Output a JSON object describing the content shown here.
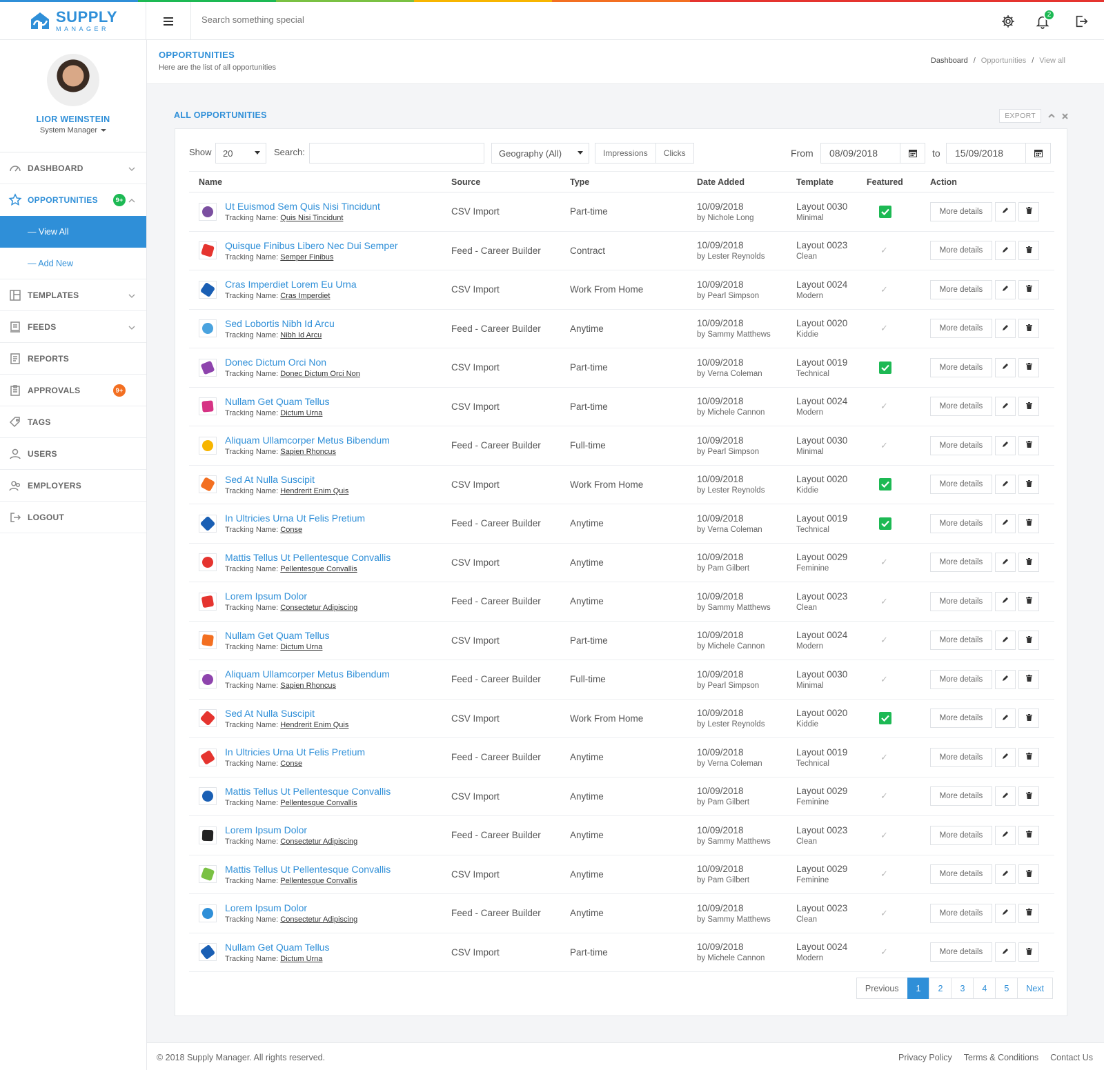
{
  "app": {
    "logo_main": "SUPPLY",
    "logo_sub": "MANAGER",
    "brand_color": "#2f8fd8",
    "rainbow_colors": [
      "#2f8fd8",
      "#1db954",
      "#7ac143",
      "#f7b500",
      "#f36f21",
      "#e5342f",
      "#e5342f",
      "#e5342f"
    ]
  },
  "topbar": {
    "menu_icon": "hamburger-icon",
    "search_placeholder": "Search something special",
    "notifications_count": "2"
  },
  "user": {
    "name": "LIOR WEINSTEIN",
    "role": "System Manager"
  },
  "sidebar": {
    "items": [
      {
        "label": "DASHBOARD",
        "icon": "speedometer-icon"
      },
      {
        "label": "OPPORTUNITIES",
        "icon": "star-icon",
        "badge": "9+"
      },
      {
        "label": "TEMPLATES",
        "icon": "layout-icon"
      },
      {
        "label": "FEEDS",
        "icon": "feed-icon"
      },
      {
        "label": "REPORTS",
        "icon": "report-icon"
      },
      {
        "label": "APPROVALS",
        "icon": "clipboard-icon",
        "badge": "9+"
      },
      {
        "label": "TAGS",
        "icon": "tag-icon"
      },
      {
        "label": "USERS",
        "icon": "user-icon"
      },
      {
        "label": "EMPLOYERS",
        "icon": "employers-icon"
      },
      {
        "label": "LOGOUT",
        "icon": "logout-icon"
      }
    ],
    "sub_items": [
      "— View All",
      "— Add New"
    ]
  },
  "page": {
    "title": "OPPORTUNITIES",
    "subtitle": "Here are the list of all opportunities",
    "breadcrumbs": [
      "Dashboard",
      "Opportunities",
      "View all"
    ]
  },
  "card": {
    "title": "ALL OPPORTUNITIES",
    "export_label": "EXPORT"
  },
  "filters": {
    "show_label": "Show",
    "show_value": "20",
    "search_label": "Search:",
    "geography": "Geography (All)",
    "toggle": [
      "Impressions",
      "Clicks"
    ],
    "from_label": "From",
    "from_date": "08/09/2018",
    "to_label": "to",
    "to_date": "15/09/2018"
  },
  "table": {
    "columns": [
      "Name",
      "Source",
      "Type",
      "Date Added",
      "Template",
      "Featured",
      "Action"
    ],
    "tracking_prefix": "Tracking Name:",
    "more_label": "More details",
    "rows": [
      {
        "name": "Ut Euismod Sem Quis Nisi Tincidunt",
        "tracking": "Quis Nisi Tincidunt",
        "source": "CSV Import",
        "type": "Part-time",
        "date": "10/09/2018",
        "by": "by Nichole Long",
        "template": "Layout 0030",
        "style": "Minimal",
        "featured": true,
        "logo": "#7b4fa0"
      },
      {
        "name": "Quisque Finibus Libero Nec Dui Semper",
        "tracking": "Semper Finibus",
        "source": "Feed - Career Builder",
        "type": "Contract",
        "date": "10/09/2018",
        "by": "by Lester Reynolds",
        "template": "Layout 0023",
        "style": "Clean",
        "featured": false,
        "logo": "#e5342f"
      },
      {
        "name": "Cras Imperdiet Lorem Eu Urna",
        "tracking": "Cras Imperdiet",
        "source": "CSV Import",
        "type": "Work From Home",
        "date": "10/09/2018",
        "by": "by Pearl Simpson",
        "template": "Layout 0024",
        "style": "Modern",
        "featured": false,
        "logo": "#1a5fb4"
      },
      {
        "name": "Sed Lobortis Nibh Id Arcu",
        "tracking": "Nibh Id Arcu",
        "source": "Feed - Career Builder",
        "type": "Anytime",
        "date": "10/09/2018",
        "by": "by Sammy Matthews",
        "template": "Layout 0020",
        "style": "Kiddie",
        "featured": false,
        "logo": "#4aa3df"
      },
      {
        "name": "Donec Dictum Orci Non",
        "tracking": "Donec Dictum Orci Non",
        "source": "CSV Import",
        "type": "Part-time",
        "date": "10/09/2018",
        "by": "by Verna Coleman",
        "template": "Layout 0019",
        "style": "Technical",
        "featured": true,
        "logo": "#8e44ad"
      },
      {
        "name": "Nullam Get Quam Tellus",
        "tracking": "Dictum Urna",
        "source": "CSV Import",
        "type": "Part-time",
        "date": "10/09/2018",
        "by": "by Michele Cannon",
        "template": "Layout 0024",
        "style": "Modern",
        "featured": false,
        "logo": "#d63384"
      },
      {
        "name": "Aliquam Ullamcorper Metus Bibendum",
        "tracking": "Sapien Rhoncus",
        "source": "Feed - Career Builder",
        "type": "Full-time",
        "date": "10/09/2018",
        "by": "by Pearl Simpson",
        "template": "Layout 0030",
        "style": "Minimal",
        "featured": false,
        "logo": "#f7b500"
      },
      {
        "name": "Sed At Nulla Suscipit",
        "tracking": "Hendrerit Enim Quis",
        "source": "CSV Import",
        "type": "Work From Home",
        "date": "10/09/2018",
        "by": "by Lester Reynolds",
        "template": "Layout 0020",
        "style": "Kiddie",
        "featured": true,
        "logo": "#f36f21"
      },
      {
        "name": "In Ultricies Urna Ut Felis Pretium",
        "tracking": "Conse",
        "source": "Feed - Career Builder",
        "type": "Anytime",
        "date": "10/09/2018",
        "by": "by Verna Coleman",
        "template": "Layout 0019",
        "style": "Technical",
        "featured": true,
        "logo": "#1a5fb4"
      },
      {
        "name": "Mattis Tellus Ut Pellentesque Convallis",
        "tracking": "Pellentesque Convallis",
        "source": "CSV Import",
        "type": "Anytime",
        "date": "10/09/2018",
        "by": "by Pam Gilbert",
        "template": "Layout 0029",
        "style": "Feminine",
        "featured": false,
        "logo": "#e5342f"
      },
      {
        "name": "Lorem Ipsum Dolor",
        "tracking": "Consectetur Adipiscing",
        "source": "Feed - Career Builder",
        "type": "Anytime",
        "date": "10/09/2018",
        "by": "by Sammy Matthews",
        "template": "Layout 0023",
        "style": "Clean",
        "featured": false,
        "logo": "#e5342f"
      },
      {
        "name": "Nullam Get Quam Tellus",
        "tracking": "Dictum Urna",
        "source": "CSV Import",
        "type": "Part-time",
        "date": "10/09/2018",
        "by": "by Michele Cannon",
        "template": "Layout 0024",
        "style": "Modern",
        "featured": false,
        "logo": "#f36f21"
      },
      {
        "name": "Aliquam Ullamcorper Metus Bibendum",
        "tracking": "Sapien Rhoncus",
        "source": "Feed - Career Builder",
        "type": "Full-time",
        "date": "10/09/2018",
        "by": "by Pearl Simpson",
        "template": "Layout 0030",
        "style": "Minimal",
        "featured": false,
        "logo": "#8e44ad"
      },
      {
        "name": "Sed At Nulla Suscipit",
        "tracking": "Hendrerit Enim Quis",
        "source": "CSV Import",
        "type": "Work From Home",
        "date": "10/09/2018",
        "by": "by Lester Reynolds",
        "template": "Layout 0020",
        "style": "Kiddie",
        "featured": true,
        "logo": "#e5342f"
      },
      {
        "name": "In Ultricies Urna Ut Felis Pretium",
        "tracking": "Conse",
        "source": "Feed - Career Builder",
        "type": "Anytime",
        "date": "10/09/2018",
        "by": "by Verna Coleman",
        "template": "Layout 0019",
        "style": "Technical",
        "featured": false,
        "logo": "#e5342f"
      },
      {
        "name": "Mattis Tellus Ut Pellentesque Convallis",
        "tracking": "Pellentesque Convallis",
        "source": "CSV Import",
        "type": "Anytime",
        "date": "10/09/2018",
        "by": "by Pam Gilbert",
        "template": "Layout 0029",
        "style": "Feminine",
        "featured": false,
        "logo": "#1a5fb4"
      },
      {
        "name": "Lorem Ipsum Dolor",
        "tracking": "Consectetur Adipiscing",
        "source": "Feed - Career Builder",
        "type": "Anytime",
        "date": "10/09/2018",
        "by": "by Sammy Matthews",
        "template": "Layout 0023",
        "style": "Clean",
        "featured": false,
        "logo": "#222222"
      },
      {
        "name": "Mattis Tellus Ut Pellentesque Convallis",
        "tracking": "Pellentesque Convallis",
        "source": "CSV Import",
        "type": "Anytime",
        "date": "10/09/2018",
        "by": "by Pam Gilbert",
        "template": "Layout 0029",
        "style": "Feminine",
        "featured": false,
        "logo": "#7ac143"
      },
      {
        "name": "Lorem Ipsum Dolor",
        "tracking": "Consectetur Adipiscing",
        "source": "Feed - Career Builder",
        "type": "Anytime",
        "date": "10/09/2018",
        "by": "by Sammy Matthews",
        "template": "Layout 0023",
        "style": "Clean",
        "featured": false,
        "logo": "#2f8fd8"
      },
      {
        "name": "Nullam Get Quam Tellus",
        "tracking": "Dictum Urna",
        "source": "CSV Import",
        "type": "Part-time",
        "date": "10/09/2018",
        "by": "by Michele Cannon",
        "template": "Layout 0024",
        "style": "Modern",
        "featured": false,
        "logo": "#1a5fb4"
      }
    ]
  },
  "pagination": {
    "previous": "Previous",
    "pages": [
      "1",
      "2",
      "3",
      "4",
      "5"
    ],
    "current": "1",
    "next": "Next"
  },
  "footer": {
    "copyright": "© 2018 Supply Manager. All rights reserved.",
    "links": [
      "Privacy Policy",
      "Terms & Conditions",
      "Contact Us"
    ]
  }
}
